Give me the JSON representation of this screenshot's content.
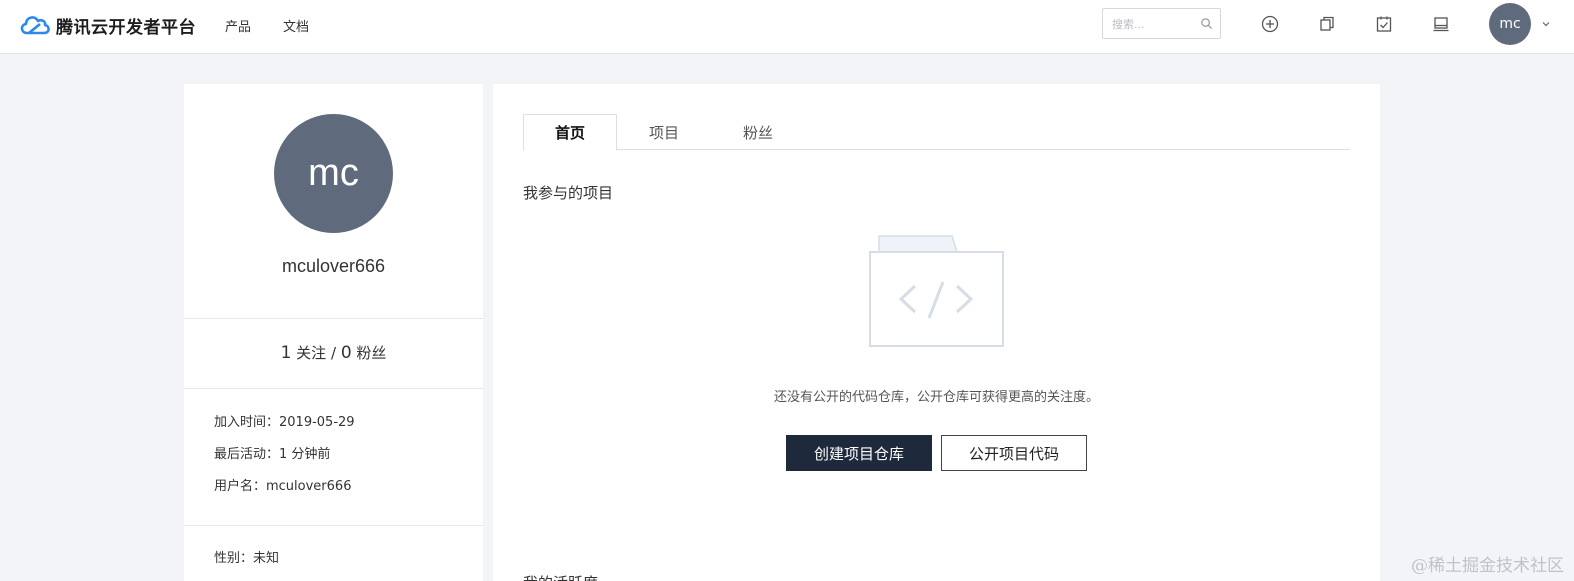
{
  "navbar": {
    "brand": "腾讯云开发者平台",
    "links": {
      "products": "产品",
      "docs": "文档"
    },
    "search": {
      "placeholder": "搜索...",
      "value": ""
    },
    "icons": [
      "plus-circle-icon",
      "copy-icon",
      "clipboard-check-icon",
      "laptop-icon"
    ],
    "avatar_initials": "mc"
  },
  "profile": {
    "avatar_initials": "mc",
    "username": "mculover666",
    "following_count": "1",
    "following_label": "关注",
    "separator": "/",
    "followers_count": "0",
    "followers_label": "粉丝",
    "join_date": "加入时间：2019-05-29",
    "last_active": "最后活动：1 分钟前",
    "username_line": "用户名：mculover666",
    "gender": "性别：未知"
  },
  "main": {
    "tabs": [
      {
        "label": "首页",
        "active": true
      },
      {
        "label": "项目",
        "active": false
      },
      {
        "label": "粉丝",
        "active": false
      }
    ],
    "section_title": "我参与的项目",
    "empty_message": "还没有公开的代码仓库，公开仓库可获得更高的关注度。",
    "create_repo_button": "创建项目仓库",
    "publish_code_button": "公开项目代码",
    "section_title_2": "我的活跃度"
  },
  "watermark": "@稀土掘金技术社区",
  "colors": {
    "avatar_bg": "#5f6b7d",
    "primary_button": "#1e2a3b",
    "page_bg": "#f3f4f7"
  }
}
